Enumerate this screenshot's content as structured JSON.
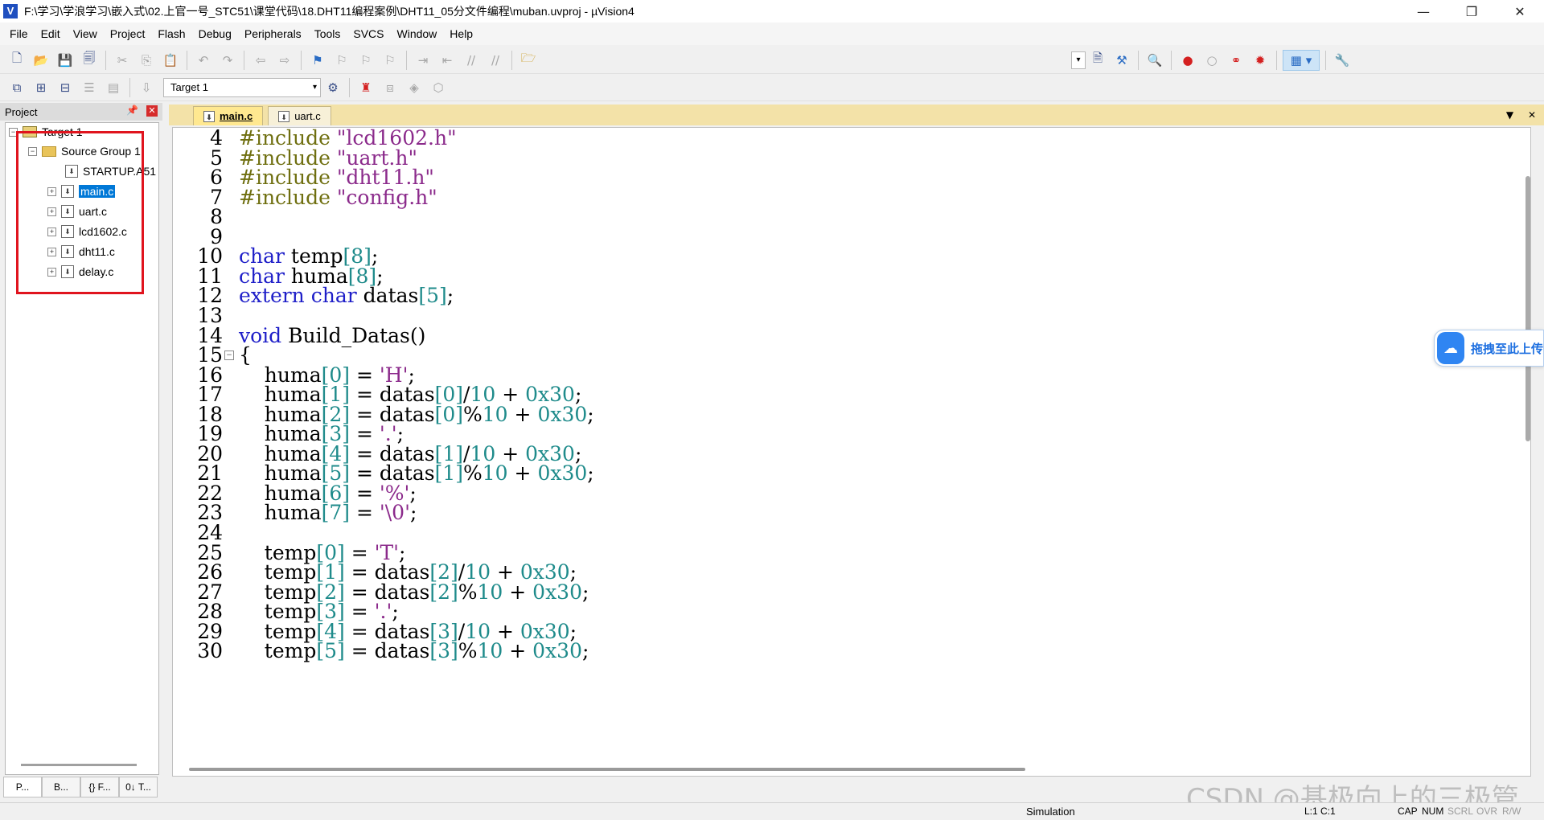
{
  "window": {
    "title": "F:\\学习\\学浪学习\\嵌入式\\02.上官一号_STC51\\课堂代码\\18.DHT11编程案例\\DHT11_05分文件编程\\muban.uvproj - µVision4",
    "app_icon": "V",
    "minimize": "—",
    "restore": "❐",
    "close": "✕"
  },
  "menu": [
    "File",
    "Edit",
    "View",
    "Project",
    "Flash",
    "Debug",
    "Peripherals",
    "Tools",
    "SVCS",
    "Window",
    "Help"
  ],
  "toolbar2": {
    "target_select": "Target 1"
  },
  "project_panel": {
    "title": "Project",
    "tree": {
      "target": "Target 1",
      "group": "Source Group 1",
      "files": [
        "STARTUP.A51",
        "main.c",
        "uart.c",
        "lcd1602.c",
        "dht11.c",
        "delay.c"
      ],
      "selected": "main.c"
    },
    "tabs": [
      "P...",
      "B...",
      "{} F...",
      "0↓ T..."
    ]
  },
  "editor": {
    "tabs": [
      {
        "label": "main.c",
        "active": true
      },
      {
        "label": "uart.c",
        "active": false
      }
    ],
    "lines": [
      {
        "n": "4",
        "text": "#include \"lcd1602.h\""
      },
      {
        "n": "5",
        "text": "#include \"uart.h\""
      },
      {
        "n": "6",
        "text": "#include \"dht11.h\""
      },
      {
        "n": "7",
        "text": "#include \"config.h\""
      },
      {
        "n": "8",
        "text": ""
      },
      {
        "n": "9",
        "text": ""
      },
      {
        "n": "10",
        "text": "char temp[8];"
      },
      {
        "n": "11",
        "text": "char huma[8];"
      },
      {
        "n": "12",
        "text": "extern char datas[5];"
      },
      {
        "n": "13",
        "text": ""
      },
      {
        "n": "14",
        "text": "void Build_Datas()"
      },
      {
        "n": "15",
        "text": "{"
      },
      {
        "n": "16",
        "text": "    huma[0] = 'H';"
      },
      {
        "n": "17",
        "text": "    huma[1] = datas[0]/10 + 0x30;"
      },
      {
        "n": "18",
        "text": "    huma[2] = datas[0]%10 + 0x30;"
      },
      {
        "n": "19",
        "text": "    huma[3] = '.';"
      },
      {
        "n": "20",
        "text": "    huma[4] = datas[1]/10 + 0x30;"
      },
      {
        "n": "21",
        "text": "    huma[5] = datas[1]%10 + 0x30;"
      },
      {
        "n": "22",
        "text": "    huma[6] = '%';"
      },
      {
        "n": "23",
        "text": "    huma[7] = '\\0';"
      },
      {
        "n": "24",
        "text": ""
      },
      {
        "n": "25",
        "text": "    temp[0] = 'T';"
      },
      {
        "n": "26",
        "text": "    temp[1] = datas[2]/10 + 0x30;"
      },
      {
        "n": "27",
        "text": "    temp[2] = datas[2]%10 + 0x30;"
      },
      {
        "n": "28",
        "text": "    temp[3] = '.';"
      },
      {
        "n": "29",
        "text": "    temp[4] = datas[3]/10 + 0x30;"
      },
      {
        "n": "30",
        "text": "    temp[5] = datas[3]%10 + 0x30;"
      }
    ]
  },
  "upload_widget": {
    "label": "拖拽至此上传"
  },
  "statusbar": {
    "mode": "Simulation",
    "position": "L:1 C:1",
    "keys": [
      "CAP",
      "NUM",
      "SCRL",
      "OVR",
      "R/W"
    ]
  },
  "watermark": "CSDN @基极向上的三极管",
  "colors": {
    "keyword": "#1e1ec8",
    "string": "#8b2a8b",
    "preprocessor": "#6f6f10",
    "number": "#1f8b8b",
    "selection": "#0078d7",
    "annotation_box": "#e0141e"
  }
}
